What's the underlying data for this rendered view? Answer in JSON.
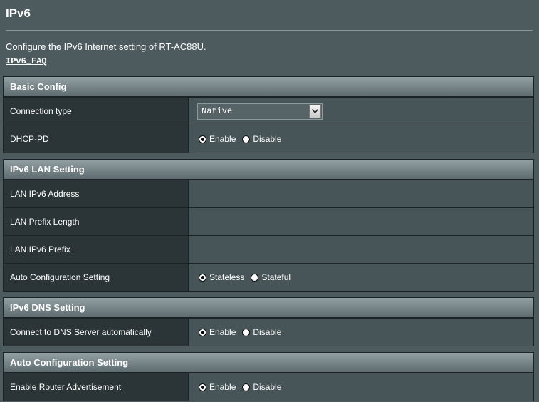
{
  "page": {
    "title": "IPv6",
    "description": "Configure the IPv6 Internet setting of RT-AC88U.",
    "faq_link": "IPv6_FAQ"
  },
  "sections": [
    {
      "header": "Basic Config",
      "rows": [
        {
          "label": "Connection type",
          "select_value": "Native"
        },
        {
          "label": "DHCP-PD",
          "options": [
            "Enable",
            "Disable"
          ],
          "selected": "Enable"
        }
      ]
    },
    {
      "header": "IPv6 LAN Setting",
      "rows": [
        {
          "label": "LAN IPv6 Address"
        },
        {
          "label": "LAN Prefix Length"
        },
        {
          "label": "LAN IPv6 Prefix"
        },
        {
          "label": "Auto Configuration Setting",
          "options": [
            "Stateless",
            "Stateful"
          ],
          "selected": "Stateless"
        }
      ]
    },
    {
      "header": "IPv6 DNS Setting",
      "rows": [
        {
          "label": "Connect to DNS Server automatically",
          "options": [
            "Enable",
            "Disable"
          ],
          "selected": "Enable"
        }
      ]
    },
    {
      "header": "Auto Configuration Setting",
      "rows": [
        {
          "label": "Enable Router Advertisement",
          "options": [
            "Enable",
            "Disable"
          ],
          "selected": "Enable"
        }
      ]
    }
  ]
}
